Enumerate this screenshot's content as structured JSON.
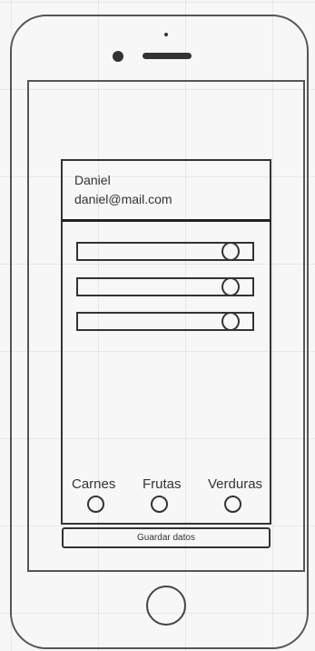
{
  "profile": {
    "name": "Daniel",
    "email": "daniel@mail.com"
  },
  "form": {
    "fields": [
      {
        "value": ""
      },
      {
        "value": ""
      },
      {
        "value": ""
      }
    ]
  },
  "categories": [
    {
      "label": "Carnes",
      "selected": false
    },
    {
      "label": "Frutas",
      "selected": false
    },
    {
      "label": "Verduras",
      "selected": false
    }
  ],
  "actions": {
    "save_label": "Guardar datos"
  }
}
